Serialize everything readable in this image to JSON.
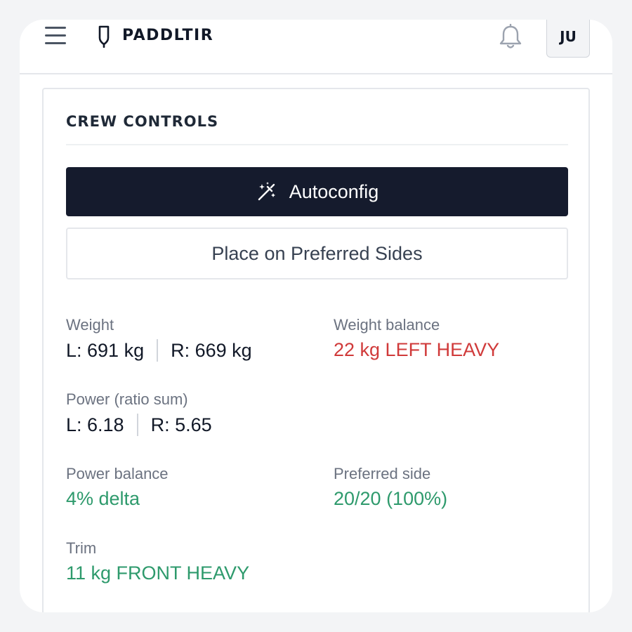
{
  "header": {
    "brand": "PADDLTIR",
    "avatar_initials": "JU",
    "icons": [
      "menu-icon",
      "paddle-logo-icon",
      "bell-icon"
    ]
  },
  "card": {
    "title": "CREW CONTROLS",
    "autoconfig_label": "Autoconfig",
    "autoconfig_icon": "magic-wand-icon",
    "preferred_sides_label": "Place on Preferred Sides"
  },
  "stats": {
    "weight": {
      "label": "Weight",
      "left": "L: 691 kg",
      "right": "R: 669 kg"
    },
    "weight_balance": {
      "label": "Weight balance",
      "value": "22 kg LEFT HEAVY",
      "color": "#d03a3a"
    },
    "power": {
      "label": "Power (ratio sum)",
      "left": "L: 6.18",
      "right": "R: 5.65"
    },
    "power_balance": {
      "label": "Power balance",
      "value": "4% delta",
      "color": "#2e9a6c"
    },
    "preferred_side": {
      "label": "Preferred side",
      "value": "20/20 (100%)",
      "color": "#2e9a6c"
    },
    "trim": {
      "label": "Trim",
      "value": "11 kg FRONT HEAVY",
      "color": "#2e9a6c"
    }
  },
  "colors": {
    "primary_button": "#151b2d",
    "warning": "#d03a3a",
    "ok": "#2e9a6c"
  }
}
